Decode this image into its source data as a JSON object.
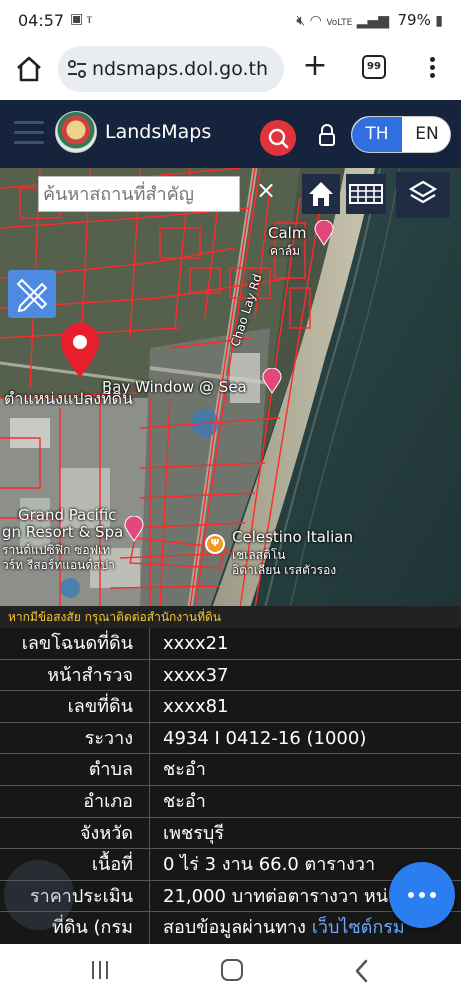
{
  "status_bar": {
    "time": "04:57",
    "left_icons": [
      "image-icon",
      "signal-antenna-icon"
    ],
    "right_icons": [
      "mute-icon",
      "wifi-icon",
      "volte-icon",
      "cell-signal-icon"
    ],
    "battery": "79%"
  },
  "browser": {
    "url": "ndsmaps.dol.go.th",
    "tab_count": "99"
  },
  "app": {
    "title": "LandsMaps",
    "lang_th": "TH",
    "lang_en": "EN"
  },
  "map": {
    "search_placeholder": "ค้นหาสถานที่สำคัญ",
    "clear_label": "×",
    "labels": {
      "calm": "Calm",
      "calm_th": "คาล์ม",
      "road": "Chao Lay Rd",
      "bay_window": "Bay Window @ Sea",
      "parcel_position": "ตำแหน่งแปลงที่ดิน",
      "grand_pacific_1": "Grand Pacific",
      "grand_pacific_2": "gn Resort & Spa",
      "grand_pacific_th1": "รานด์แปซิฟิก ซอฟเท",
      "grand_pacific_th2": "วร์ท รีสอร์ทแอนด์สปา",
      "celestino": "Celestino Italian",
      "celestino_th1": "เชเลสติโน",
      "celestino_th2": "อิตาเลียน เรสตัวรอง"
    }
  },
  "info": {
    "notice": "หากมีข้อสงสัย กรุณาติดต่อสำนักงานที่ดิน",
    "rows": [
      {
        "label": "เลขโฉนดที่ดิน",
        "value": "xxxx21"
      },
      {
        "label": "หน้าสำรวจ",
        "value": "xxxx37"
      },
      {
        "label": "เลขที่ดิน",
        "value": "xxxx81"
      },
      {
        "label": "ระวาง",
        "value": "4934 I 0412-16 (1000)"
      },
      {
        "label": "ตำบล",
        "value": "ชะอำ"
      },
      {
        "label": "อำเภอ",
        "value": "ชะอำ"
      },
      {
        "label": "จังหวัด",
        "value": "เพชรบุรี"
      },
      {
        "label": "เนื้อที่",
        "value": "0 ไร่ 3 งาน 66.0 ตารางวา"
      },
      {
        "label": "ราคาประเมิน",
        "value": "21,000 บาทต่อตารางวา หน่วย"
      },
      {
        "label": "ที่ดิน (กรม",
        "value": "สอบข้อมูลผ่านทาง",
        "link": "เว็บไซต์กรม"
      }
    ]
  },
  "colors": {
    "header_bg": "#15243c",
    "accent_blue": "#2f6fe0",
    "search_red": "#e0333c",
    "parcel_red": "#ff2a2a",
    "notice_yellow": "#f5c930"
  }
}
